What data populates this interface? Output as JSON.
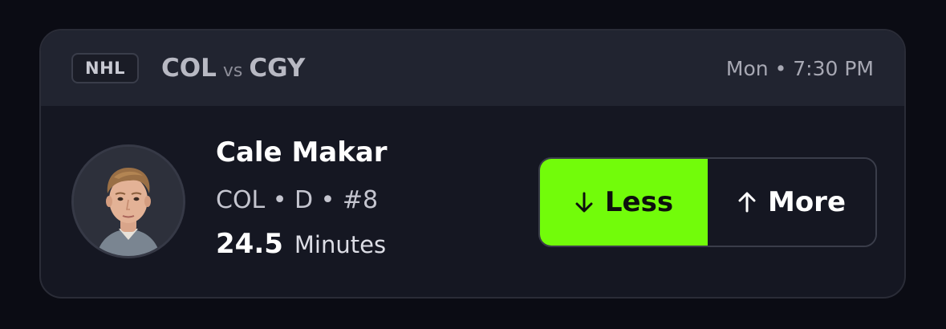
{
  "header": {
    "league": "NHL",
    "home_team": "COL",
    "vs_label": "vs",
    "away_team": "CGY",
    "game_time": "Mon • 7:30 PM"
  },
  "player": {
    "name": "Cale Makar",
    "meta": "COL • D • #8",
    "stat_value": "24.5",
    "stat_label": "Minutes"
  },
  "picks": {
    "less_label": "Less",
    "more_label": "More",
    "selected": "less",
    "selected_color": "#72fc0a"
  },
  "icons": {
    "less": "arrow-down-icon",
    "more": "arrow-up-icon"
  }
}
